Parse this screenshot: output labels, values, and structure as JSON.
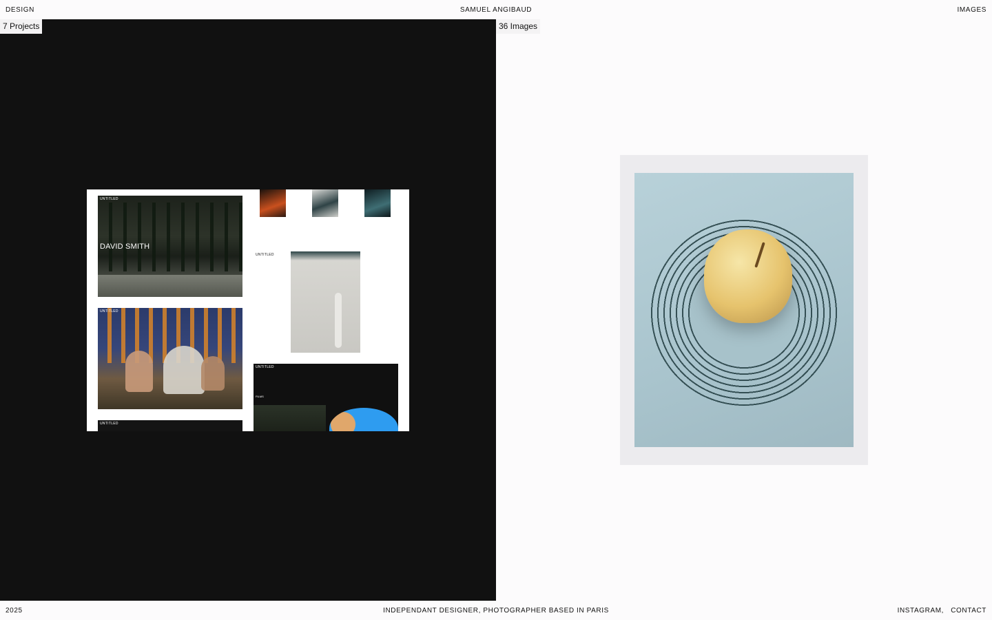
{
  "nav": {
    "left": "DESIGN",
    "center": "SAMUEL ANGIBAUD",
    "right": "IMAGES"
  },
  "design": {
    "count": "7 Projects",
    "preview": {
      "card1_label": "UNTITLED",
      "card1_hero": "DAVID SMITH",
      "card2_label": "UNTITLED",
      "card3_label": "UNTITLED",
      "card5_label": "UNTITLED",
      "card6_label": "UNTITLED",
      "card6_films": "FILMS"
    }
  },
  "images": {
    "count": "36 Images"
  },
  "footer": {
    "year": "2025",
    "tagline": "INDEPENDANT DESIGNER, PHOTOGRAPHER BASED IN PARIS",
    "links": [
      "INSTAGRAM,",
      "CONTACT"
    ]
  },
  "colors": {
    "left_panel": "#111111",
    "right_panel": "#fcfbfc",
    "text": "#111111"
  }
}
